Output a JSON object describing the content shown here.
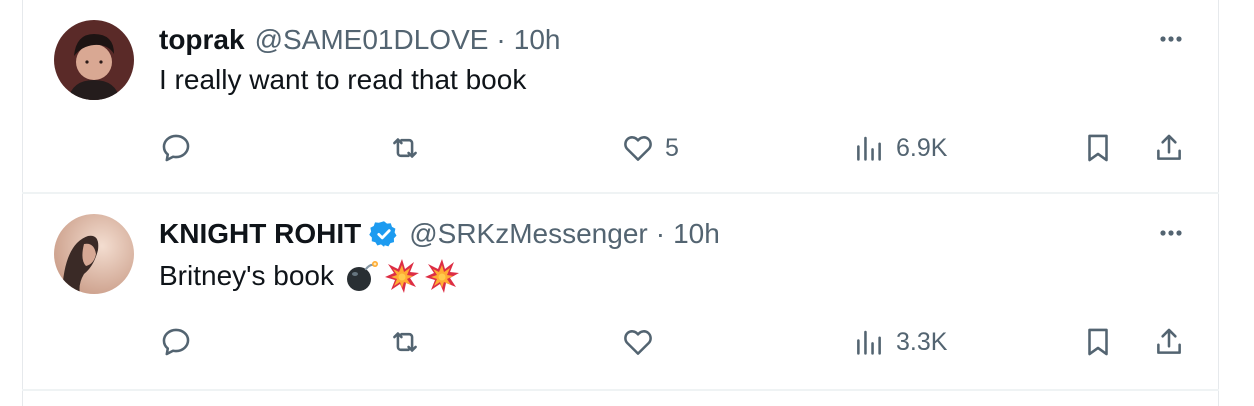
{
  "tweets": [
    {
      "display_name": "toprak",
      "handle": "@SAME01DLOVE",
      "separator": "·",
      "time": "10h",
      "verified": false,
      "text": "I really want to read that book",
      "emoji": [],
      "stats": {
        "replies": "",
        "retweets": "",
        "likes": "5",
        "views": "6.9K"
      }
    },
    {
      "display_name": "KNIGHT ROHIT",
      "handle": "@SRKzMessenger",
      "separator": "·",
      "time": "10h",
      "verified": true,
      "text": "Britney's book",
      "emoji": [
        "bomb-emoji",
        "collision-emoji",
        "collision-emoji"
      ],
      "stats": {
        "replies": "",
        "retweets": "",
        "likes": "",
        "views": "3.3K"
      }
    }
  ],
  "colors": {
    "text": "#0f1419",
    "secondary": "#536471",
    "verified": "#1d9bf0",
    "divider": "#eff3f4"
  }
}
